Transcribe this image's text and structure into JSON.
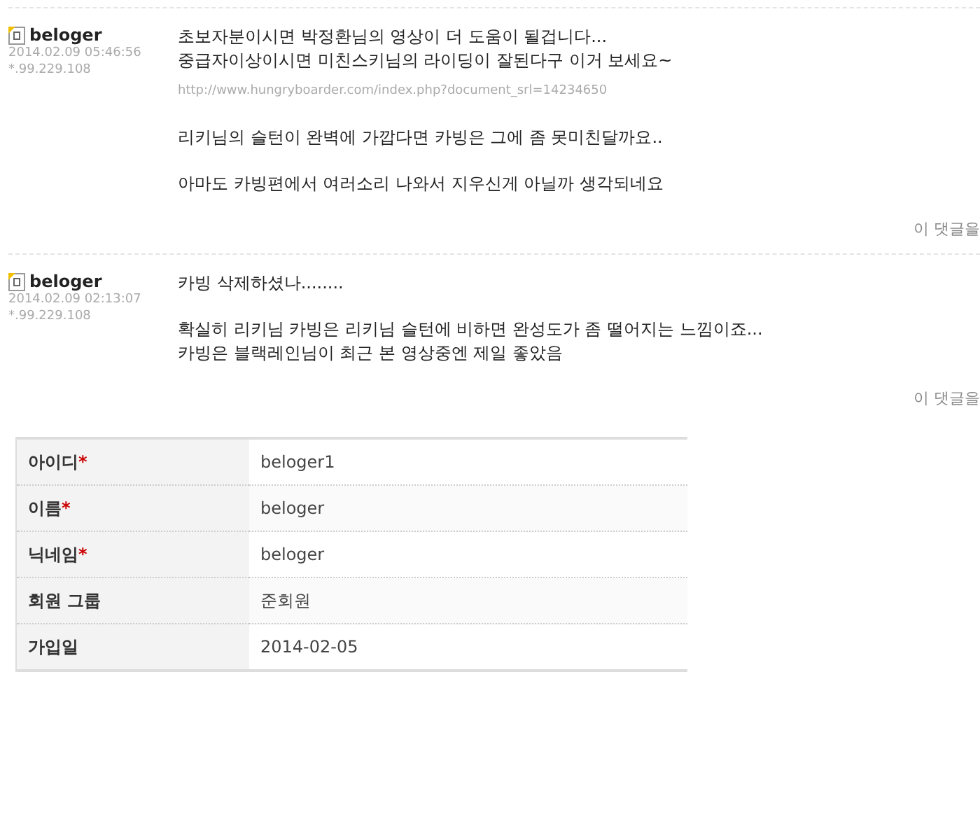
{
  "comments": [
    {
      "author": "beloger",
      "date": "2014.02.09 05:46:56",
      "ip": "*.99.229.108",
      "blocks": [
        {
          "kind": "text",
          "lines": [
            "초보자분이시면 박정환님의 영상이 더 도움이 될겁니다...",
            "중급자이상이시면 미친스키님의 라이딩이 잘된다구 이거 보세요~"
          ]
        },
        {
          "kind": "link",
          "lines": [
            "http://www.hungryboarder.com/index.php?document_srl=14234650"
          ]
        },
        {
          "kind": "text",
          "lines": [
            "리키님의 슬턴이 완벽에 가깝다면 카빙은 그에 좀 못미친달까요.."
          ]
        },
        {
          "kind": "text",
          "lines": [
            "아마도 카빙편에서 여러소리 나와서 지우신게 아닐까 생각되네요"
          ]
        }
      ],
      "action": "이 댓글을"
    },
    {
      "author": "beloger",
      "date": "2014.02.09 02:13:07",
      "ip": "*.99.229.108",
      "blocks": [
        {
          "kind": "text",
          "lines": [
            "카빙 삭제하셨나........"
          ]
        },
        {
          "kind": "text",
          "lines": [
            "확실히 리키님 카빙은 리키님 슬턴에 비하면 완성도가 좀 떨어지는 느낌이죠...",
            "카빙은 블랙레인님이 최근 본 영상중엔 제일 좋았음"
          ]
        }
      ],
      "action": "이 댓글을"
    }
  ],
  "profile": [
    {
      "label": "아이디",
      "required": "*",
      "value": "beloger1"
    },
    {
      "label": "이름",
      "required": "*",
      "value": "beloger"
    },
    {
      "label": "닉네임",
      "required": "*",
      "value": "beloger"
    },
    {
      "label": "회원 그룹",
      "value": "준회원"
    },
    {
      "label": "가입일",
      "value": "2014-02-05"
    }
  ]
}
